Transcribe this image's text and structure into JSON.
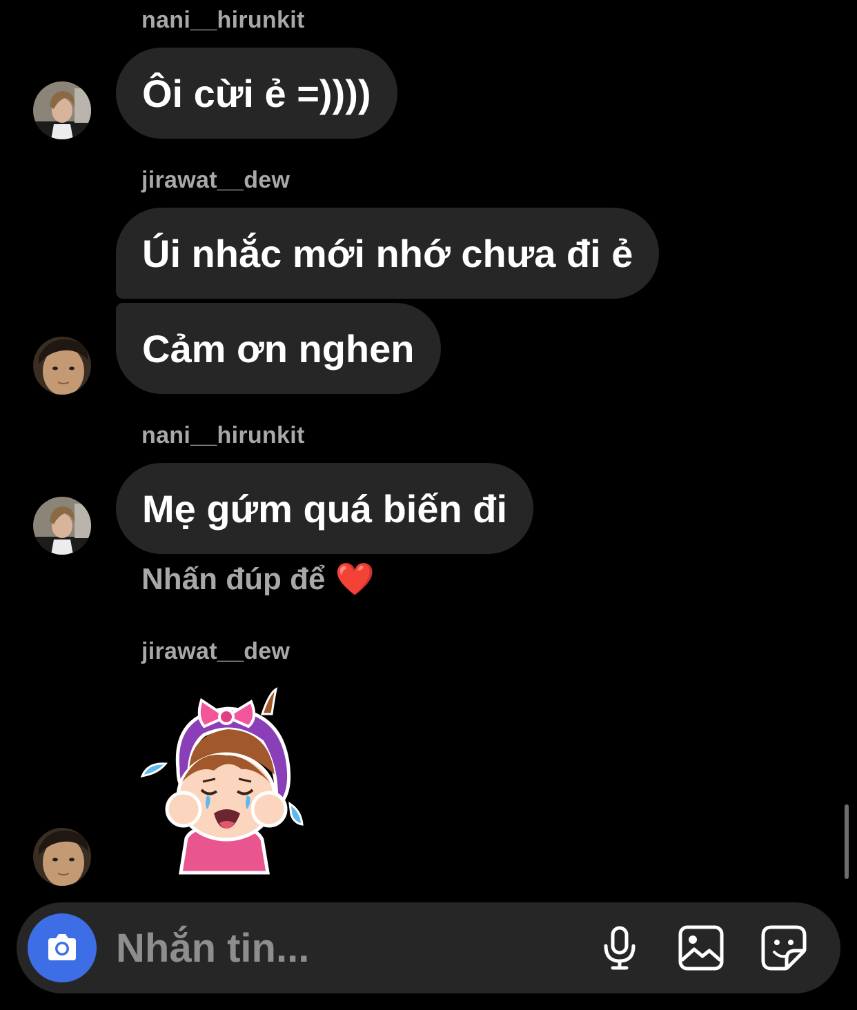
{
  "messages": [
    {
      "sender": "nani__hirunkit",
      "texts": [
        "Ôi cừi ẻ =))))"
      ]
    },
    {
      "sender": "jirawat__dew",
      "texts": [
        "Úi nhắc mới nhớ chưa đi ẻ",
        "Cảm ơn nghen"
      ]
    },
    {
      "sender": "nani__hirunkit",
      "texts": [
        "Mẹ gứm quá biến đi"
      ]
    },
    {
      "sender": "jirawat__dew",
      "sticker": "crying-girl-sticker"
    }
  ],
  "like_hint": {
    "text": "Nhấn đúp để",
    "emoji": "❤️"
  },
  "composer": {
    "placeholder": "Nhắn tin..."
  },
  "icons": {
    "camera": "camera-icon",
    "microphone": "microphone-icon",
    "gallery": "gallery-icon",
    "sticker": "sticker-icon"
  },
  "colors": {
    "background": "#000000",
    "bubble": "#262626",
    "sender_text": "#a8a8a8",
    "camera_button": "#3e6ee6"
  }
}
